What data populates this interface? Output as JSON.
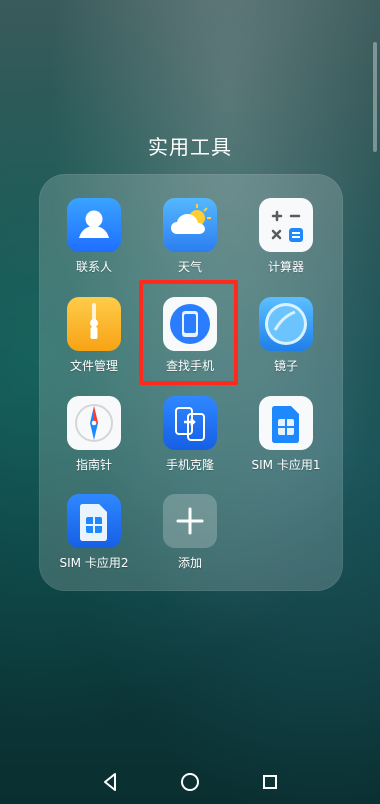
{
  "folder": {
    "title": "实用工具"
  },
  "apps": [
    {
      "label": "联系人",
      "icon": "contacts-icon"
    },
    {
      "label": "天气",
      "icon": "weather-icon"
    },
    {
      "label": "计算器",
      "icon": "calculator-icon"
    },
    {
      "label": "文件管理",
      "icon": "file-manager-icon"
    },
    {
      "label": "查找手机",
      "icon": "find-phone-icon"
    },
    {
      "label": "镜子",
      "icon": "mirror-icon"
    },
    {
      "label": "指南针",
      "icon": "compass-icon"
    },
    {
      "label": "手机克隆",
      "icon": "phone-clone-icon"
    },
    {
      "label": "SIM 卡应用1",
      "icon": "sim-card-icon"
    },
    {
      "label": "SIM 卡应用2",
      "icon": "sim-card-icon"
    },
    {
      "label": "添加",
      "icon": "plus-icon"
    }
  ],
  "navigation": {
    "back": "back-triangle-icon",
    "home": "home-circle-icon",
    "recent": "recent-square-icon"
  },
  "colors": {
    "highlight": "#ff2a1b"
  }
}
